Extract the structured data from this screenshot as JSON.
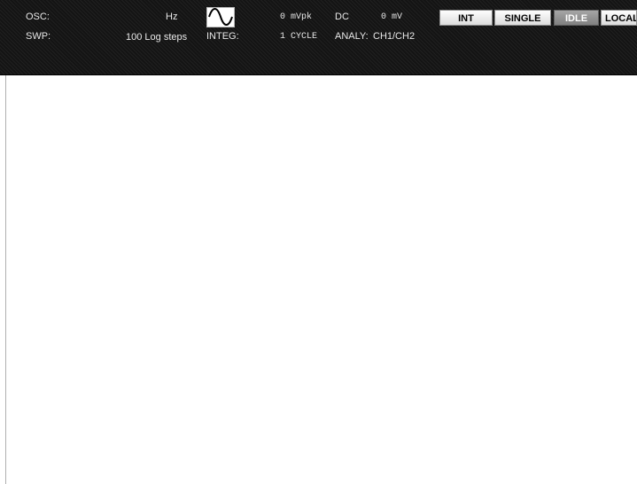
{
  "status": {
    "osc_label": "OSC:",
    "freq_unit": "Hz",
    "waveform_icon": "sine-wave-icon",
    "amplitude": "0 mVpk",
    "dc_label": "DC",
    "dc_value": "0 mV",
    "swp_label": "SWP:",
    "sweep_steps": "100 Log steps",
    "integ_label": "INTEG:",
    "integ_value": "1 CYCLE",
    "analy_label": "ANALY:",
    "analy_value": "CH1/CH2"
  },
  "buttons": {
    "int": "INT",
    "single": "SINGLE",
    "idle": "IDLE",
    "local": "LOCAL"
  },
  "colors": {
    "status_bar_bg": "#141414",
    "status_text": "#e8e8e8",
    "button_light": "#ececec",
    "button_dim": "#909090",
    "main_bg": "#ffffff"
  }
}
